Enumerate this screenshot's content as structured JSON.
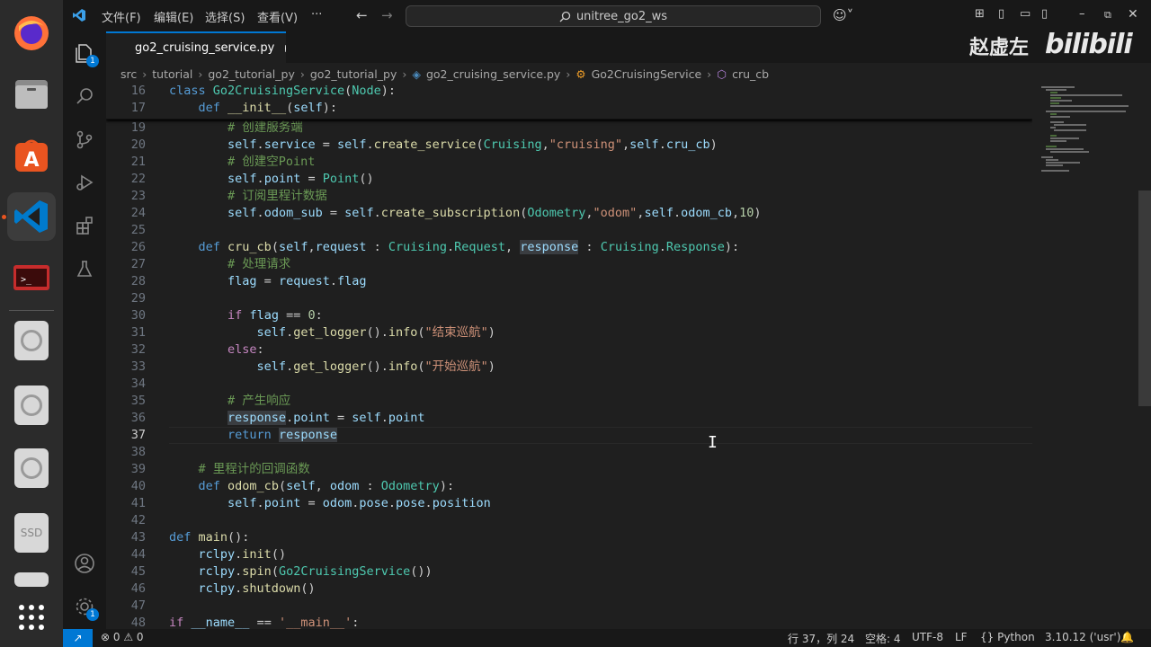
{
  "titlebar": {
    "menus": [
      "文件(F)",
      "编辑(E)",
      "选择(S)",
      "查看(V)",
      "···"
    ],
    "search": "unitree_go2_ws"
  },
  "tab": {
    "label": "go2_cruising_service.py"
  },
  "breadcrumb": [
    "src",
    "tutorial",
    "go2_tutorial_py",
    "go2_tutorial_py",
    "go2_cruising_service.py",
    "Go2CruisingService",
    "cru_cb"
  ],
  "activity": {
    "explorer_badge": "1",
    "settings_badge": "1"
  },
  "watermark": {
    "name": "赵虚左",
    "site": "bilibili"
  },
  "editor": {
    "sticky": [
      {
        "n": "16",
        "text": "class Go2CruisingService(Node):"
      },
      {
        "n": "17",
        "text": "    def __init__(self):"
      }
    ],
    "lines": [
      {
        "n": "19",
        "text": "        # 创建服务端"
      },
      {
        "n": "20",
        "text": "        self.service = self.create_service(Cruising,\"cruising\",self.cru_cb)"
      },
      {
        "n": "21",
        "text": "        # 创建空Point"
      },
      {
        "n": "22",
        "text": "        self.point = Point()"
      },
      {
        "n": "23",
        "text": "        # 订阅里程计数据"
      },
      {
        "n": "24",
        "text": "        self.odom_sub = self.create_subscription(Odometry,\"odom\",self.odom_cb,10)"
      },
      {
        "n": "25",
        "text": ""
      },
      {
        "n": "26",
        "text": "    def cru_cb(self,request : Cruising.Request, response : Cruising.Response):"
      },
      {
        "n": "27",
        "text": "        # 处理请求"
      },
      {
        "n": "28",
        "text": "        flag = request.flag"
      },
      {
        "n": "29",
        "text": ""
      },
      {
        "n": "30",
        "text": "        if flag == 0:"
      },
      {
        "n": "31",
        "text": "            self.get_logger().info(\"结束巡航\")"
      },
      {
        "n": "32",
        "text": "        else:"
      },
      {
        "n": "33",
        "text": "            self.get_logger().info(\"开始巡航\")"
      },
      {
        "n": "34",
        "text": ""
      },
      {
        "n": "35",
        "text": "        # 产生响应"
      },
      {
        "n": "36",
        "text": "        response.point = self.point"
      },
      {
        "n": "37",
        "text": "        return response"
      },
      {
        "n": "38",
        "text": ""
      },
      {
        "n": "39",
        "text": "    # 里程计的回调函数"
      },
      {
        "n": "40",
        "text": "    def odom_cb(self, odom : Odometry):"
      },
      {
        "n": "41",
        "text": "        self.point = odom.pose.pose.position"
      },
      {
        "n": "42",
        "text": ""
      },
      {
        "n": "43",
        "text": "def main():"
      },
      {
        "n": "44",
        "text": "    rclpy.init()"
      },
      {
        "n": "45",
        "text": "    rclpy.spin(Go2CruisingService())"
      },
      {
        "n": "46",
        "text": "    rclpy.shutdown()"
      },
      {
        "n": "47",
        "text": ""
      },
      {
        "n": "48",
        "text": "if __name__ == '__main__':"
      }
    ]
  },
  "status": {
    "problems": "⊗ 0 ⚠ 0",
    "position": "行 37，列 24",
    "spaces": "空格: 4",
    "encoding": "UTF-8",
    "eol": "LF",
    "language": "{} Python",
    "interpreter": "3.10.12 ('usr')"
  }
}
